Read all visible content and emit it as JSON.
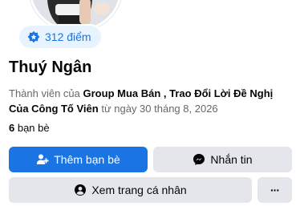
{
  "profile": {
    "points_badge": {
      "icon": "star-badge-icon",
      "text": "312 điểm"
    },
    "name": "Thuý Ngân",
    "member_info": {
      "prefix": "Thành viên của ",
      "group_name": "Group Mua Bán , Trao Đổi Lời Đề Nghị Của Công Tố Viên",
      "date_text": " từ ngày 30 tháng 8, 2026"
    },
    "friends": {
      "count": "6",
      "label": " bạn bè"
    }
  },
  "actions": {
    "add_friend_label": "Thêm bạn bè",
    "add_friend_icon": "add-friend-icon",
    "message_label": "Nhắn tin",
    "message_icon": "messenger-icon",
    "view_profile_label": "Xem trang cá nhân",
    "view_profile_icon": "profile-icon",
    "more_label": "···",
    "more_icon": "more-icon"
  },
  "colors": {
    "primary": "#1b74e4",
    "secondary_bg": "#e4e6eb",
    "badge_bg": "#e7f3ff",
    "muted_text": "#65676b"
  }
}
